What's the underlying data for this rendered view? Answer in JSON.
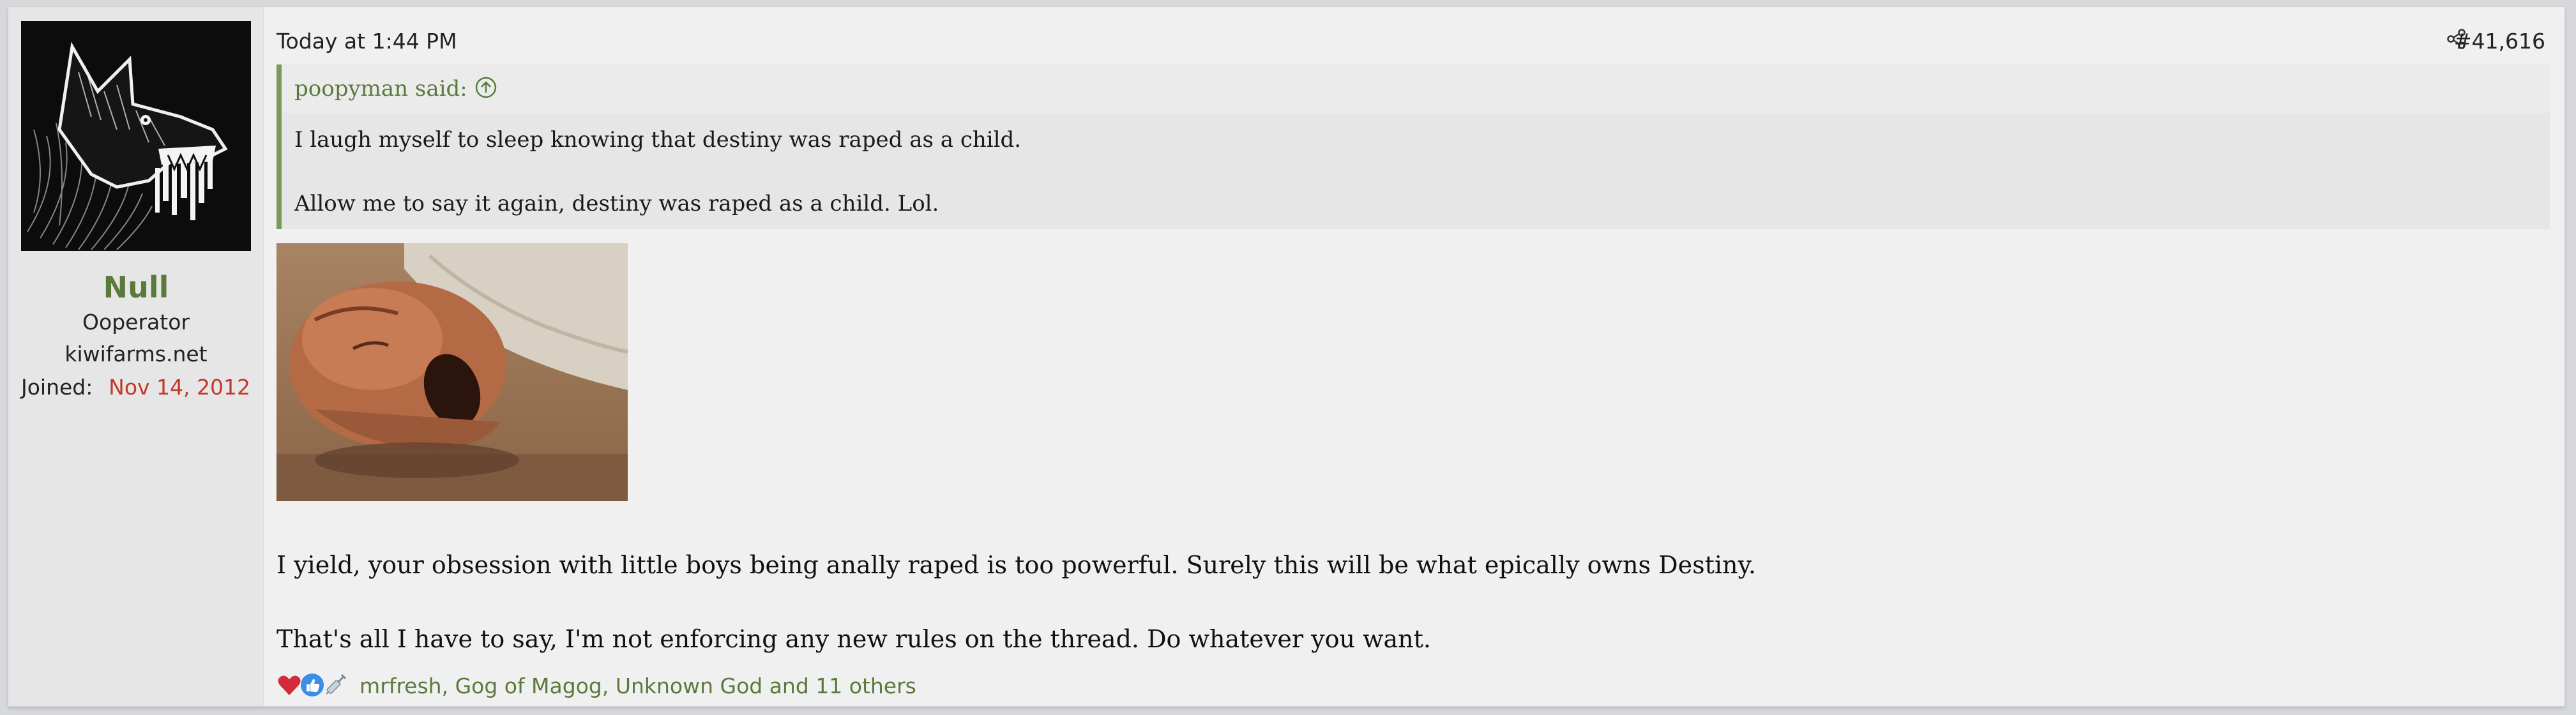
{
  "user": {
    "name": "Null",
    "title": "Ooperator",
    "site": "kiwifarms.net",
    "joined_label": "Joined:",
    "joined_date": "Nov 14, 2012"
  },
  "post": {
    "timestamp": "Today at 1:44 PM",
    "number": "#41,616",
    "quote": {
      "author": "poopyman said:",
      "lines": [
        "I laugh myself to sleep knowing that destiny was raped as a child.",
        "Allow me to say it again, destiny was raped as a child. Lol."
      ]
    },
    "body": [
      "I yield, your obsession with little boys being anally raped is too powerful. Surely this will be what epically owns Destiny.",
      "That's all I have to say, I'm not enforcing any new rules on the thread. Do whatever you want."
    ],
    "reactions": {
      "icons": [
        "heart-icon",
        "thumbs-up-icon",
        "syringe-icon"
      ],
      "users_text": "mrfresh, Gog of Magog, Unknown God and 11 others"
    }
  },
  "colors": {
    "accent_green": "#5a7a3c",
    "date_red": "#c0392b",
    "quote_border": "#7a9a5a"
  }
}
